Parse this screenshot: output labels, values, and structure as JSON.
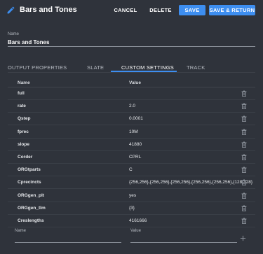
{
  "header": {
    "title": "Bars and Tones",
    "cancel_label": "CANCEL",
    "delete_label": "DELETE",
    "save_label": "SAVE",
    "save_return_label": "SAVE & RETURN"
  },
  "name_field": {
    "label": "Name",
    "value": "Bars and Tones"
  },
  "tabs": [
    {
      "label": "OUTPUT PROPERTIES"
    },
    {
      "label": "SLATE"
    },
    {
      "label": "CUSTOM SETTINGS"
    },
    {
      "label": "TRACK"
    }
  ],
  "active_tab": "CUSTOM SETTINGS",
  "table": {
    "headers": [
      "Name",
      "Value"
    ],
    "rows": [
      {
        "name": "full",
        "value": ""
      },
      {
        "name": "rate",
        "value": "2.0"
      },
      {
        "name": "Qstep",
        "value": "0.0001"
      },
      {
        "name": "fprec",
        "value": "10M"
      },
      {
        "name": "slope",
        "value": "41880"
      },
      {
        "name": "Corder",
        "value": "CPRL"
      },
      {
        "name": "ORGtparts",
        "value": "C"
      },
      {
        "name": "Cprecincts",
        "value": "{256,256},{256,256},{256,256},{256,256},{256,256},{128,128}"
      },
      {
        "name": "ORGgen_plt",
        "value": "yes"
      },
      {
        "name": "ORGgen_tlm",
        "value": "{3}"
      },
      {
        "name": "Creslengths",
        "value": "4161666"
      }
    ]
  },
  "new_entry": {
    "name_label": "Name",
    "value_label": "Value"
  },
  "colors": {
    "accent": "#3d8ef0",
    "background": "#2f333b",
    "pencil": "#3d8ef0"
  },
  "icons": {
    "edit": "pencil-icon",
    "delete": "trash-icon",
    "add": "plus-icon"
  }
}
